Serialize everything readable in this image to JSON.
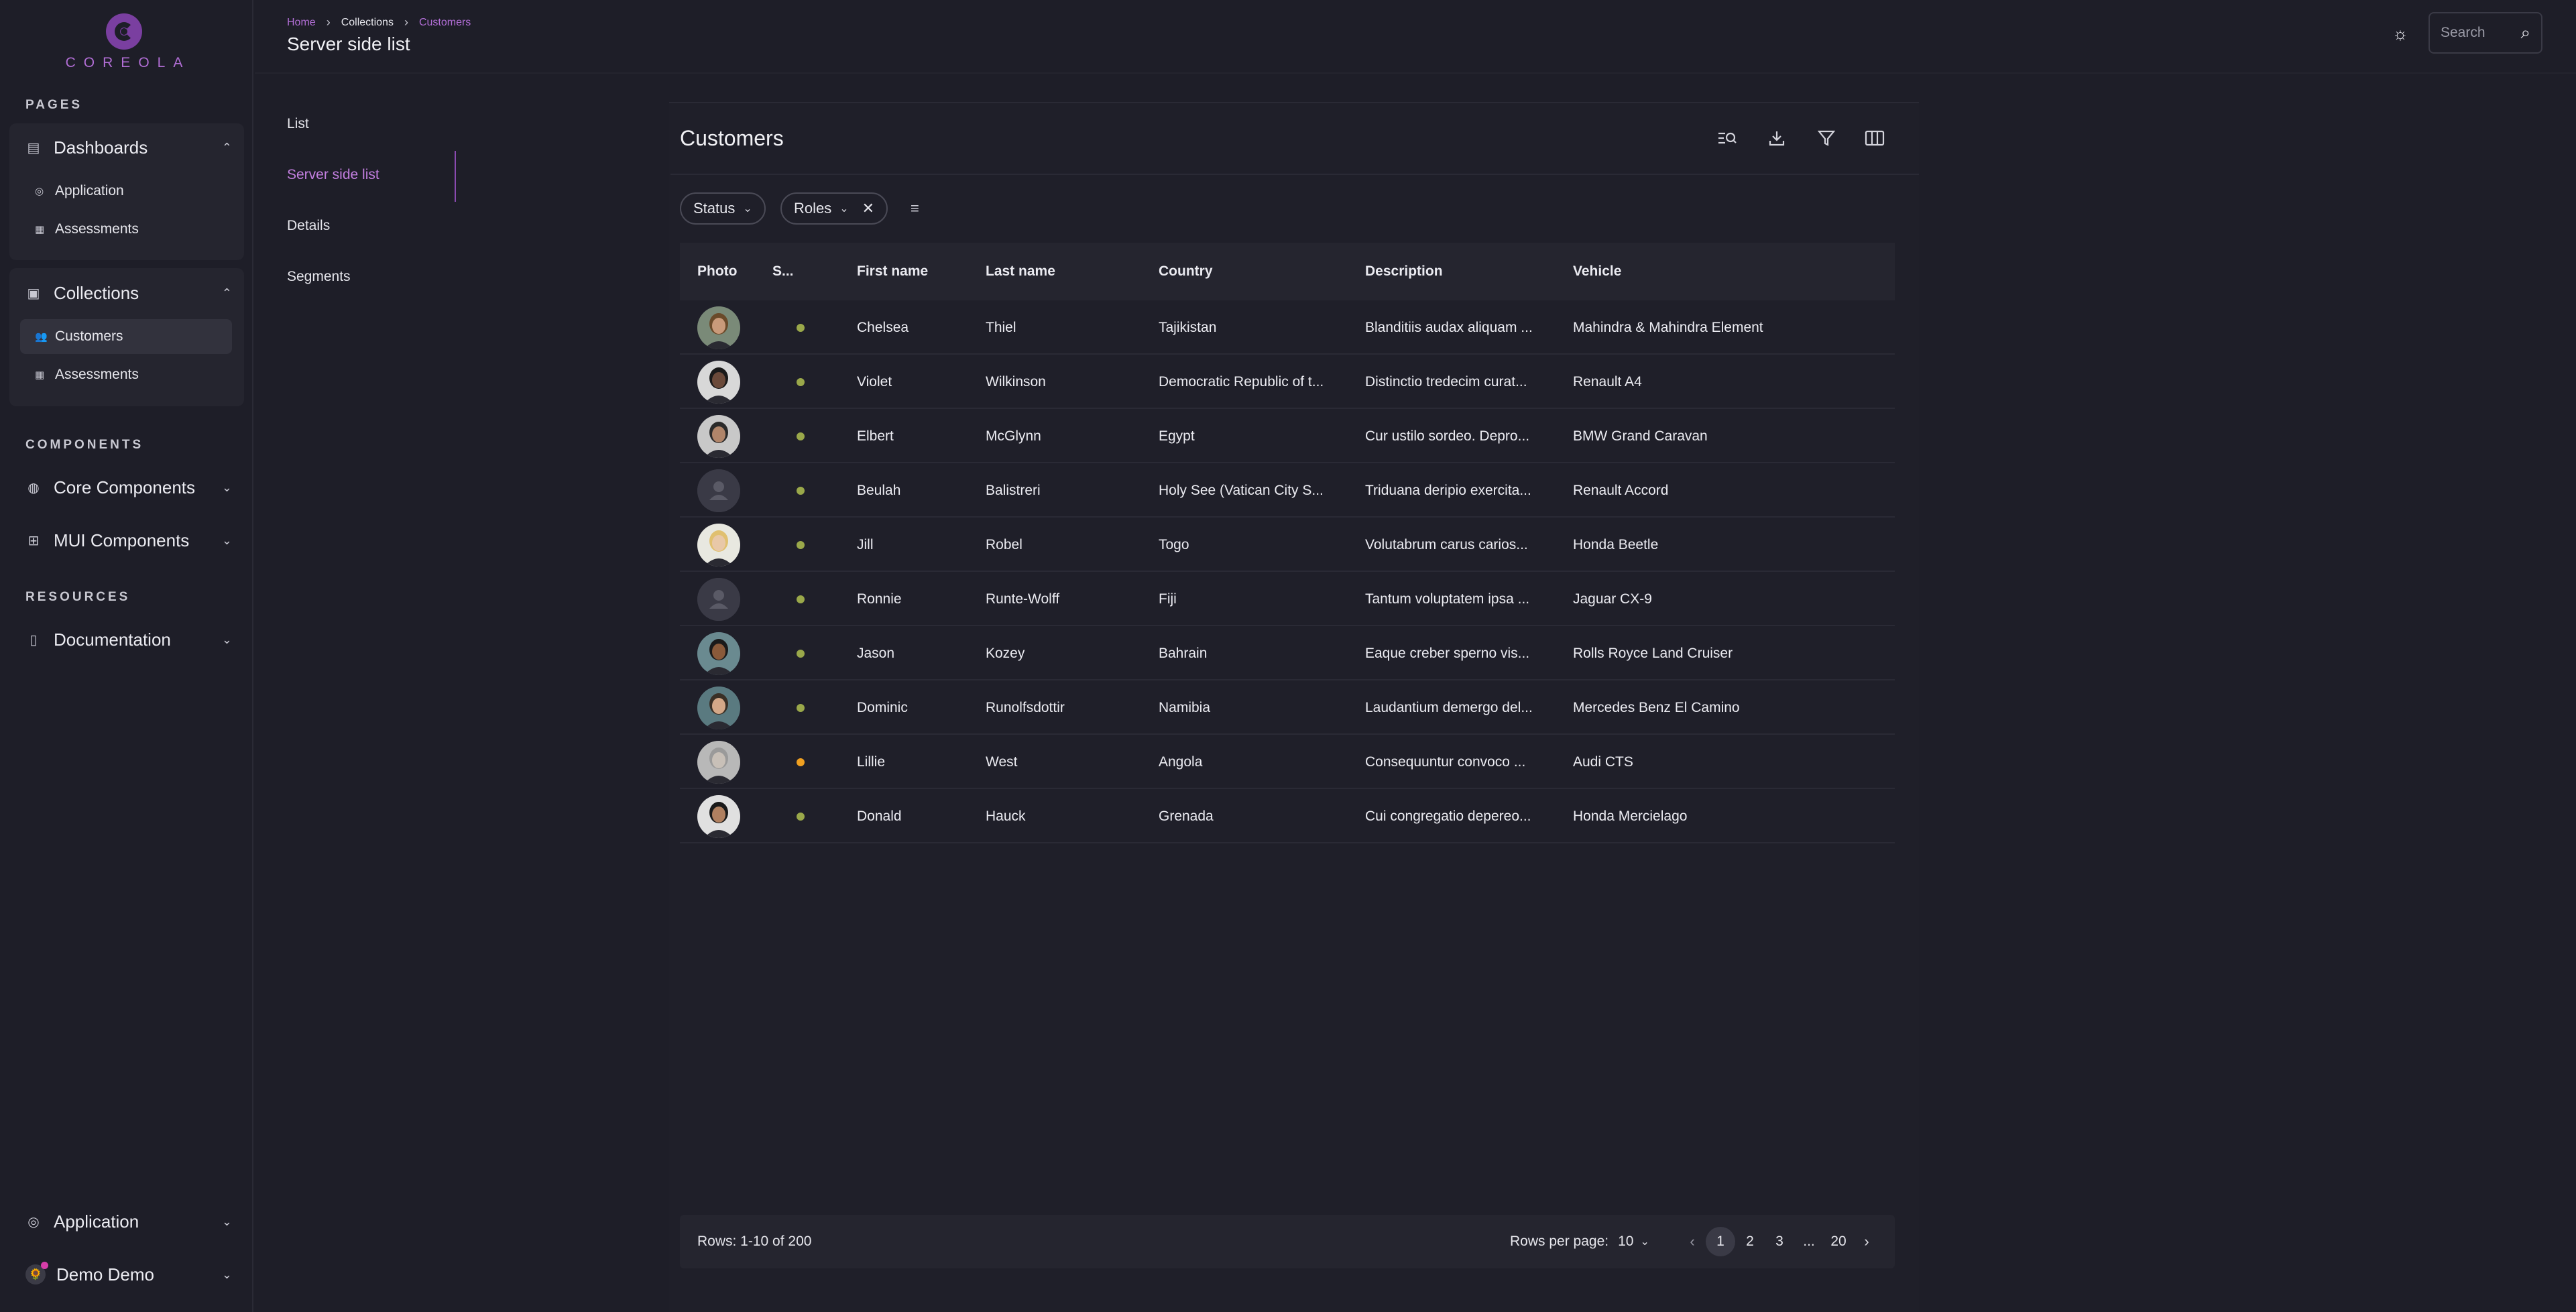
{
  "brand": {
    "logo_text": "COREOLA"
  },
  "sidebar": {
    "sections": [
      "PAGES",
      "COMPONENTS",
      "RESOURCES"
    ],
    "dashboards": {
      "label": "Dashboards",
      "items": [
        "Application",
        "Assessments"
      ]
    },
    "collections": {
      "label": "Collections",
      "items": [
        "Customers",
        "Assessments"
      ]
    },
    "core_components": "Core Components",
    "mui_components": "MUI Components",
    "documentation": "Documentation",
    "bottom_app": "Application",
    "user": "Demo Demo"
  },
  "header": {
    "breadcrumb": [
      "Home",
      "Collections",
      "Customers"
    ],
    "title": "Server side list",
    "search_placeholder": "Search"
  },
  "subnav": [
    "List",
    "Server side list",
    "Details",
    "Segments"
  ],
  "panel": {
    "title": "Customers",
    "filters": {
      "status": "Status",
      "roles": "Roles"
    }
  },
  "table": {
    "columns": [
      "Photo",
      "S...",
      "First name",
      "Last name",
      "Country",
      "Description",
      "Vehicle"
    ],
    "rows": [
      {
        "first": "Chelsea",
        "last": "Thiel",
        "country": "Tajikistan",
        "description": "Blanditiis audax aliquam ...",
        "vehicle": "Mahindra & Mahindra Element",
        "status_color": "#9aa84a"
      },
      {
        "first": "Violet",
        "last": "Wilkinson",
        "country": "Democratic Republic of t...",
        "description": "Distinctio tredecim curat...",
        "vehicle": "Renault A4",
        "status_color": "#9aa84a"
      },
      {
        "first": "Elbert",
        "last": "McGlynn",
        "country": "Egypt",
        "description": "Cur ustilo sordeo. Depro...",
        "vehicle": "BMW Grand Caravan",
        "status_color": "#9aa84a"
      },
      {
        "first": "Beulah",
        "last": "Balistreri",
        "country": "Holy See (Vatican City S...",
        "description": "Triduana deripio exercita...",
        "vehicle": "Renault Accord",
        "status_color": "#9aa84a"
      },
      {
        "first": "Jill",
        "last": "Robel",
        "country": "Togo",
        "description": "Volutabrum carus carios...",
        "vehicle": "Honda Beetle",
        "status_color": "#9aa84a"
      },
      {
        "first": "Ronnie",
        "last": "Runte-Wolff",
        "country": "Fiji",
        "description": "Tantum voluptatem ipsa ...",
        "vehicle": "Jaguar CX-9",
        "status_color": "#9aa84a"
      },
      {
        "first": "Jason",
        "last": "Kozey",
        "country": "Bahrain",
        "description": "Eaque creber sperno vis...",
        "vehicle": "Rolls Royce Land Cruiser",
        "status_color": "#9aa84a"
      },
      {
        "first": "Dominic",
        "last": "Runolfsdottir",
        "country": "Namibia",
        "description": "Laudantium demergo del...",
        "vehicle": "Mercedes Benz El Camino",
        "status_color": "#9aa84a"
      },
      {
        "first": "Lillie",
        "last": "West",
        "country": "Angola",
        "description": "Consequuntur convoco ...",
        "vehicle": "Audi CTS",
        "status_color": "#f0a020"
      },
      {
        "first": "Donald",
        "last": "Hauck",
        "country": "Grenada",
        "description": "Cui congregatio depereo...",
        "vehicle": "Honda Mercielago",
        "status_color": "#9aa84a"
      }
    ]
  },
  "footer": {
    "rows_info": "Rows: 1-10 of 200",
    "rows_per_page_label": "Rows per page:",
    "rows_per_page_value": "10",
    "pages": [
      "1",
      "2",
      "3",
      "...",
      "20"
    ]
  },
  "colors": {
    "accent": "#b26ed6",
    "background": "#1e1e28"
  }
}
